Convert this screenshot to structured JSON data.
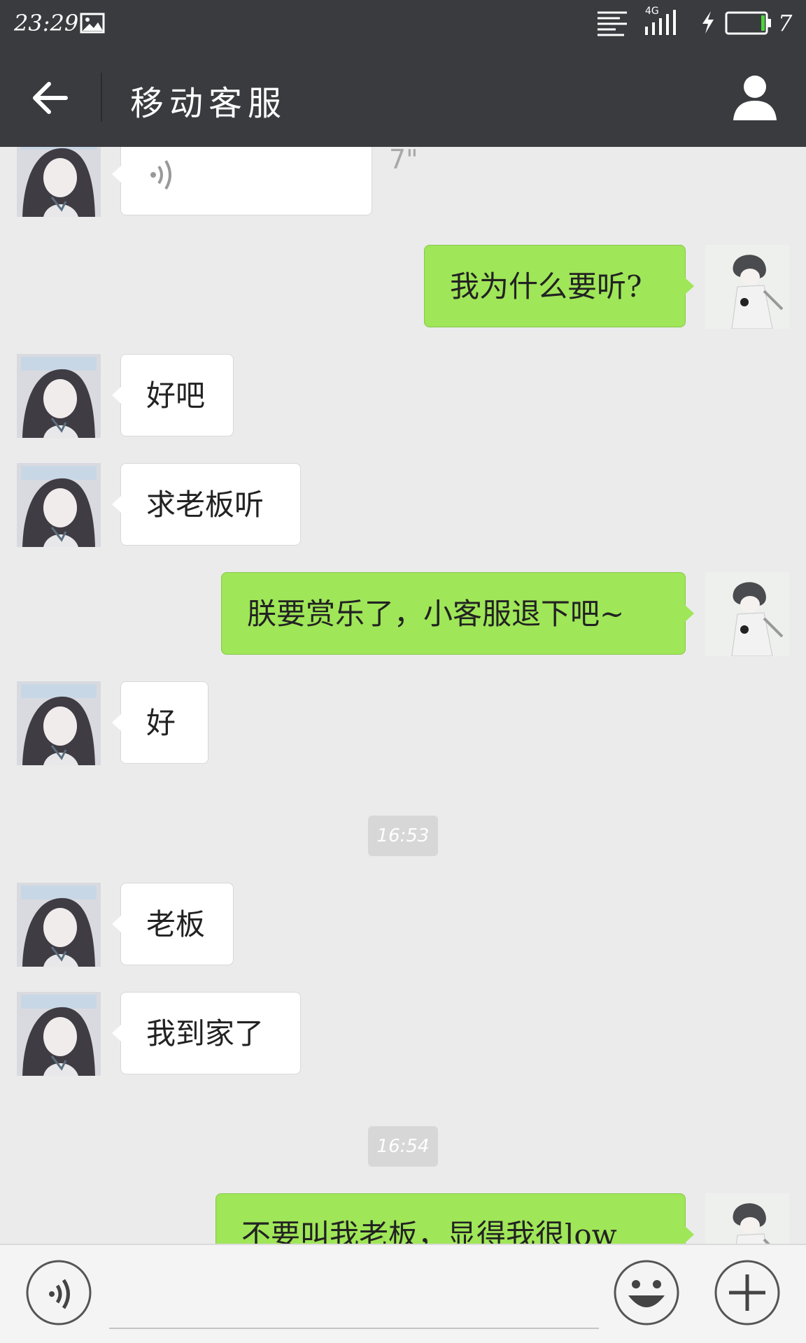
{
  "status_bar": {
    "time": "23:29",
    "network": "4G",
    "battery": "7",
    "icons": [
      "gallery-icon",
      "menu-lines-icon",
      "signal-icon",
      "charging-icon",
      "battery-icon"
    ]
  },
  "header": {
    "title": "移动客服",
    "back_icon": "arrow-left-icon",
    "profile_icon": "person-icon"
  },
  "colors": {
    "header_bg": "#3a3b3f",
    "chat_bg": "#ebebeb",
    "outgoing_bubble": "#9fe658",
    "incoming_bubble": "#ffffff",
    "battery_level": "#4cd43c"
  },
  "messages": [
    {
      "side": "incoming",
      "type": "voice",
      "duration": "7\""
    },
    {
      "side": "outgoing",
      "text": "我为什么要听?"
    },
    {
      "side": "incoming",
      "text": "好吧"
    },
    {
      "side": "incoming",
      "text": "求老板听"
    },
    {
      "side": "outgoing",
      "text": "朕要赏乐了，小客服退下吧~"
    },
    {
      "side": "incoming",
      "text": "好"
    },
    {
      "type": "time",
      "text": "16:53"
    },
    {
      "side": "incoming",
      "text": "老板"
    },
    {
      "side": "incoming",
      "text": "我到家了"
    },
    {
      "type": "time",
      "text": "16:54"
    },
    {
      "side": "outgoing",
      "text": "不要叫我老板，显得我很low"
    }
  ],
  "input_bar": {
    "value": "",
    "voice_icon": "voice-toggle-icon",
    "emoji_icon": "smiley-icon",
    "plus_icon": "plus-icon"
  }
}
